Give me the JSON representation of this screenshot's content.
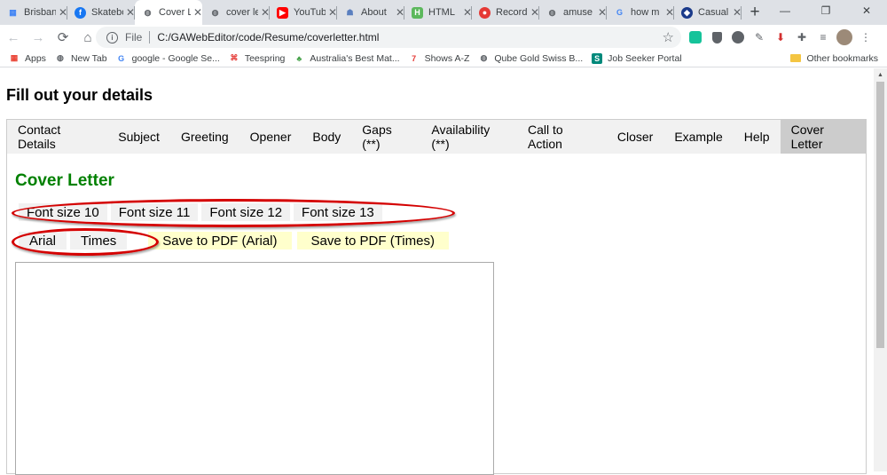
{
  "browser": {
    "tabs": [
      {
        "label": "Brisbane",
        "icon": "apps-grid-icon",
        "color": "#4285f4"
      },
      {
        "label": "Skateboard",
        "icon": "facebook-icon",
        "color": "#1877f2"
      },
      {
        "label": "Cover Letter",
        "icon": "globe-icon",
        "color": "#5f6368",
        "active": true
      },
      {
        "label": "cover letter",
        "icon": "globe-icon",
        "color": "#5f6368"
      },
      {
        "label": "YouTube",
        "icon": "youtube-icon",
        "color": "#ff0000"
      },
      {
        "label": "About",
        "icon": "about-icon",
        "color": "#5a7fbf"
      },
      {
        "label": "HTML",
        "icon": "html-icon",
        "color": "#5cb85c"
      },
      {
        "label": "Record",
        "icon": "record-icon",
        "color": "#e53935"
      },
      {
        "label": "amuse",
        "icon": "globe-icon",
        "color": "#5f6368"
      },
      {
        "label": "how m",
        "icon": "google-icon",
        "color": "#4285f4"
      },
      {
        "label": "Casual",
        "icon": "casual-icon",
        "color": "#1a3a8a"
      }
    ],
    "new_tab": "+",
    "window_controls": {
      "minimize": "—",
      "maximize": "❐",
      "close": "✕"
    },
    "omnibox": {
      "scheme": "File",
      "url": "C:/GAWebEditor/code/Resume/coverletter.html"
    },
    "bookmarks": [
      {
        "label": "Apps",
        "icon": "apps-grid-icon"
      },
      {
        "label": "New Tab",
        "icon": "globe-icon"
      },
      {
        "label": "google - Google Se...",
        "icon": "google-icon"
      },
      {
        "label": "Teespring",
        "icon": "teespring-icon"
      },
      {
        "label": "Australia's Best Mat...",
        "icon": "plant-icon"
      },
      {
        "label": "Shows A-Z",
        "icon": "seven-icon"
      },
      {
        "label": "Qube Gold Swiss B...",
        "icon": "globe-icon"
      },
      {
        "label": "Job Seeker Portal",
        "icon": "jobseeker-icon"
      }
    ],
    "other_bookmarks": "Other bookmarks"
  },
  "page": {
    "title": "Fill out your details",
    "nav": [
      "Contact Details",
      "Subject",
      "Greeting",
      "Opener",
      "Body",
      "Gaps (**)",
      "Availability (**)",
      "Call to Action",
      "Closer",
      "Example",
      "Help",
      "Cover Letter"
    ],
    "active_nav": "Cover Letter",
    "section_title": "Cover Letter",
    "font_size_buttons": [
      "Font size 10",
      "Font size 11",
      "Font size 12",
      "Font size 13"
    ],
    "font_buttons": [
      "Arial",
      "Times"
    ],
    "pdf_buttons": [
      "Save to PDF (Arial)",
      "Save to PDF (Times)"
    ],
    "colors": {
      "section_title": "#008000",
      "pdf_button_bg": "#ffffcc",
      "annotation_ring": "#d40000",
      "active_tab": "#cccccc"
    }
  }
}
